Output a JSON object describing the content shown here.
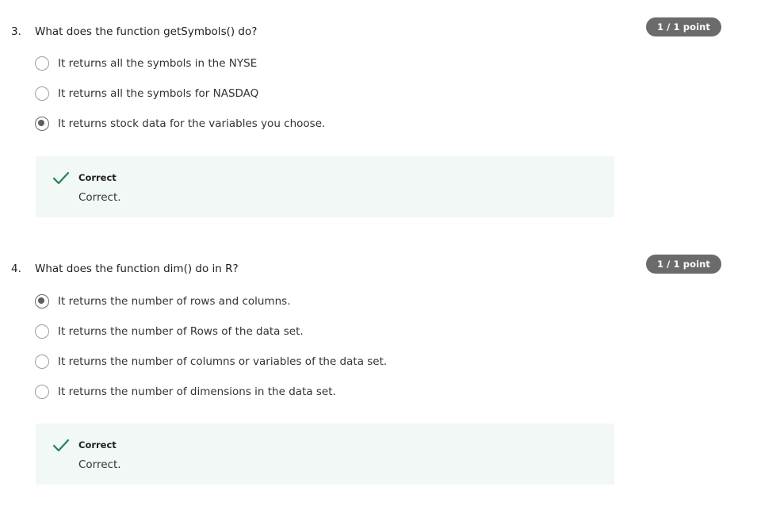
{
  "questions": [
    {
      "number": "3.",
      "text": "What does the function getSymbols() do?",
      "points": "1 / 1 point",
      "options": [
        {
          "label": "It returns all the symbols in the NYSE",
          "selected": false
        },
        {
          "label": "It returns all the symbols for NASDAQ",
          "selected": false
        },
        {
          "label": "It returns stock data for the variables you choose.",
          "selected": true
        }
      ],
      "feedback": {
        "title": "Correct",
        "text": "Correct.",
        "icon": "checkmark-icon",
        "color": "#1f8354"
      }
    },
    {
      "number": "4.",
      "text": "What does the function dim() do in R?",
      "points": "1 / 1 point",
      "options": [
        {
          "label": "It returns the number of rows and columns.",
          "selected": true
        },
        {
          "label": "It returns the number of Rows of the data set.",
          "selected": false
        },
        {
          "label": "It returns the number of columns or variables of the data set.",
          "selected": false
        },
        {
          "label": "It returns the number of dimensions in the data set.",
          "selected": false
        }
      ],
      "feedback": {
        "title": "Correct",
        "text": "Correct.",
        "icon": "checkmark-icon",
        "color": "#1f8354"
      }
    }
  ]
}
